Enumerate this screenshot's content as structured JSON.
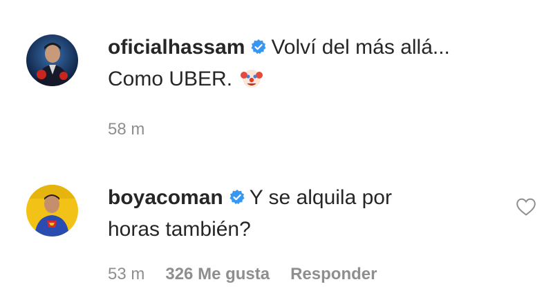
{
  "comments": [
    {
      "username": "oficialhassam",
      "verified": true,
      "text_line1": "Volví del más allá...",
      "text_line2": "Como UBER.",
      "emoji": "clown-face",
      "time": "58 m"
    },
    {
      "username": "boyacoman",
      "verified": true,
      "text_line1": "Y se alquila por",
      "text_line2": "horas también?",
      "time": "53 m",
      "likes": "326 Me gusta",
      "reply_label": "Responder"
    }
  ],
  "colors": {
    "text": "#262626",
    "meta": "#8e8e8e",
    "verified": "#3897f0"
  },
  "icons": [
    "verified-badge-icon",
    "clown-emoji-icon",
    "heart-outline-icon"
  ]
}
